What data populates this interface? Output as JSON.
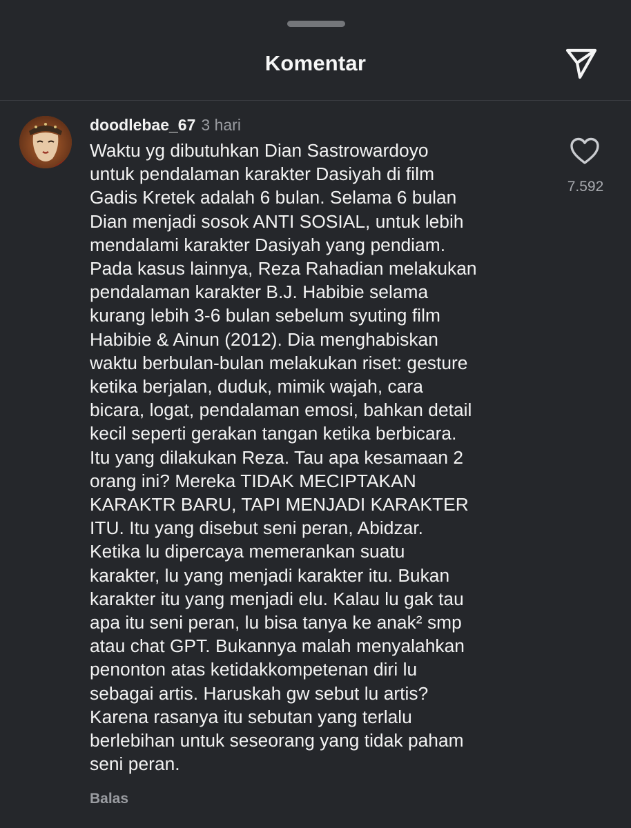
{
  "header": {
    "title": "Komentar",
    "share_icon": "paper-plane-icon"
  },
  "comment": {
    "username": "doodlebae_67",
    "timestamp": "3 hari",
    "avatar_icon": "mask-avatar",
    "text": "Waktu yg dibutuhkan Dian Sastrowardoyo\nuntuk pendalaman karakter Dasiyah di film\nGadis Kretek adalah 6 bulan. Selama 6 bulan\nDian menjadi sosok ANTI SOSIAL, untuk lebih\nmendalami karakter Dasiyah yang pendiam.\nPada kasus lainnya, Reza Rahadian melakukan\npendalaman karakter B.J. Habibie selama\nkurang lebih 3-6 bulan sebelum syuting film\nHabibie & Ainun (2012). Dia menghabiskan\nwaktu berbulan-bulan melakukan riset: gesture\nketika berjalan, duduk, mimik wajah, cara\nbicara, logat, pendalaman emosi, bahkan detail\nkecil seperti gerakan tangan ketika berbicara.\nItu yang dilakukan Reza. Tau apa kesamaan 2\norang ini? Mereka TIDAK MECIPTAKAN\nKARAKTR BARU, TAPI MENJADI KARAKTER\nITU. Itu yang disebut seni peran, Abidzar.\nKetika lu dipercaya memerankan suatu\nkarakter, lu yang menjadi karakter itu. Bukan\nkarakter itu yang menjadi elu. Kalau lu gak tau\napa itu seni peran, lu bisa tanya ke anak² smp\natau chat GPT. Bukannya malah menyalahkan\npenonton atas ketidakkompetenan diri lu\nsebagai artis. Haruskah gw sebut lu artis?\nKarena rasanya itu sebutan yang terlalu\nberlebihan untuk seseorang yang tidak paham\nseni peran.",
    "reply_label": "Balas",
    "like_icon": "heart-icon",
    "like_count": "7.592"
  },
  "colors": {
    "background": "#25272b",
    "text_primary": "#f3f3f3",
    "text_secondary": "#9a9ca1"
  }
}
